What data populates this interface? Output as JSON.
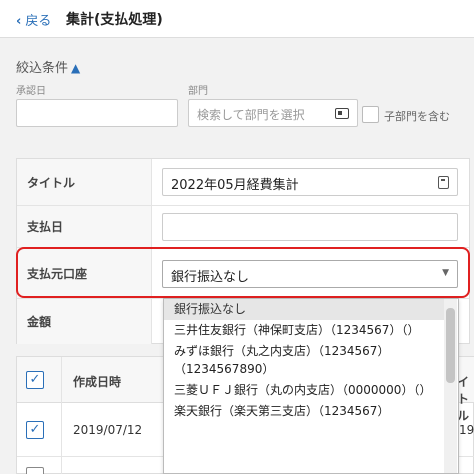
{
  "header": {
    "back_label": "戻る",
    "title": "集計(支払処理)"
  },
  "filter": {
    "toggle_label": "絞込条件",
    "approval_date_label": "承認日",
    "approval_date_value": "",
    "department_label": "部門",
    "department_placeholder": "検索して部門を選択",
    "include_sub_label": "子部門を含む"
  },
  "form": {
    "title_label": "タイトル",
    "title_value": "2022年05月経費集計",
    "pay_date_label": "支払日",
    "pay_date_value": "",
    "source_account_label": "支払元口座",
    "source_account_value": "銀行振込なし",
    "amount_label": "金額"
  },
  "dropdown": {
    "options": [
      "銀行振込なし",
      "三井住友銀行（神保町支店）（1234567）（）",
      "みずほ銀行（丸之内支店）（1234567）（1234567890）",
      "三菱ＵＦＪ銀行（丸の内支店）（0000000）（）",
      "楽天銀行（楽天第三支店）（1234567）"
    ],
    "selected_index": 0
  },
  "list": {
    "col_created": "作成日時",
    "col_title_partial": "イトル",
    "rows": [
      {
        "created": "2019/07/12",
        "checked": true,
        "trail": "19"
      },
      {
        "created": "",
        "checked": false,
        "trail": ""
      }
    ]
  },
  "colors": {
    "accent": "#2a6fb8",
    "highlight": "#e02020"
  },
  "icons": [
    "chevron-left-icon",
    "chevron-up-icon",
    "card-icon",
    "calculator-icon",
    "chevron-down-icon",
    "checkmark-icon"
  ]
}
